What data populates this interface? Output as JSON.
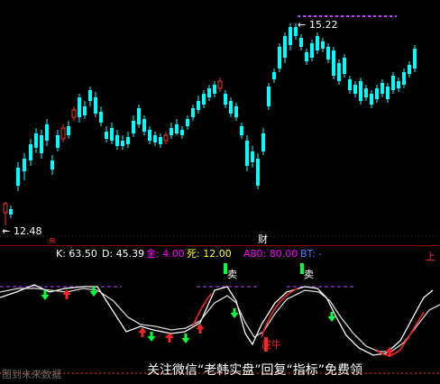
{
  "price_panel": {
    "high_label": "15.22",
    "low_label": "12.48",
    "finance_marker": "财"
  },
  "indicator_header": {
    "k": "K: 63.50",
    "d": "D: 45.39",
    "gold": "金: 4.00",
    "death": "死: 12.00",
    "a80": "A80: 80.00",
    "bt": "BT: -",
    "up_marker": "上"
  },
  "indicator_signals": {
    "sell_1": "卖",
    "sell_2": "卖",
    "bottom_bull": "底牛"
  },
  "watermark": {
    "text": "关注微信“老韩实盘”回复“指标”免费领",
    "left_text": "图到未来数据"
  },
  "colors": {
    "background": "#000000",
    "up_candle": "#ff3030",
    "down_candle": "#00ffff",
    "k_line": "#ffffff",
    "d_line": "#ffffff",
    "gold_text": "#ff00ff",
    "death_text": "#ffff00",
    "a80_text": "#ff00ff",
    "bt_text": "#4d7cff",
    "header_text": "#ffffff",
    "signal_down": "#00ff40",
    "signal_up": "#ff2020",
    "dashed_level": "#c040ff"
  }
}
